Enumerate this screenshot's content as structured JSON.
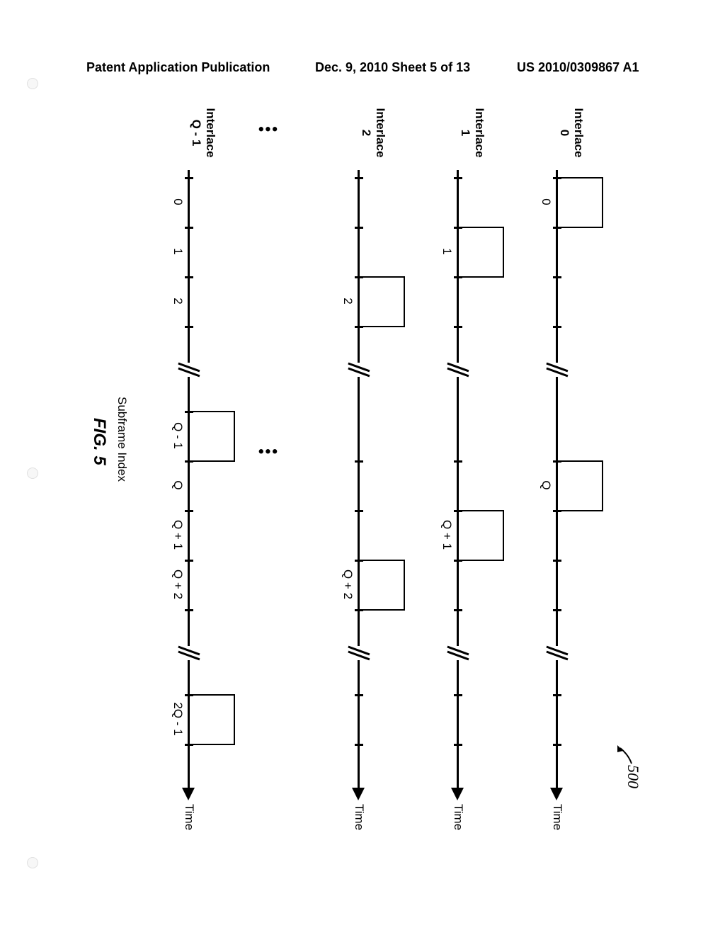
{
  "header": {
    "left": "Patent Application Publication",
    "mid": "Dec. 9, 2010   Sheet 5 of 13",
    "right": "US 2010/0309867 A1"
  },
  "ref_num": "500",
  "fig_label": "FIG. 5",
  "xaxis_label": "Subframe Index",
  "time_label": "Time",
  "rows": [
    {
      "label_line1": "Interlace",
      "label_line2": "0",
      "slots": [
        {
          "pos": 0,
          "label": "0"
        },
        {
          "pos": 5,
          "label": "Q"
        }
      ],
      "ticks": [
        0,
        1,
        2,
        3,
        5,
        6,
        7,
        8,
        10,
        11
      ],
      "show_index_labels": false
    },
    {
      "label_line1": "Interlace",
      "label_line2": "1",
      "slots": [
        {
          "pos": 1,
          "label": "1"
        },
        {
          "pos": 6,
          "label": "Q + 1"
        }
      ],
      "ticks": [
        0,
        1,
        2,
        3,
        5,
        6,
        7,
        8,
        10,
        11
      ],
      "show_index_labels": false
    },
    {
      "label_line1": "Interlace",
      "label_line2": "2",
      "slots": [
        {
          "pos": 2,
          "label": "2"
        },
        {
          "pos": 7,
          "label": "Q + 2"
        }
      ],
      "ticks": [
        0,
        1,
        2,
        3,
        5,
        6,
        7,
        8,
        10,
        11
      ],
      "show_index_labels": false
    },
    {
      "label_line1": "Interlace",
      "label_line2": "Q - 1",
      "slots": [
        {
          "pos": 4,
          "label": "Q - 1"
        },
        {
          "pos": 10,
          "label": "2Q - 1"
        }
      ],
      "ticks": [
        0,
        1,
        2,
        3,
        4,
        5,
        6,
        7,
        8,
        10,
        11
      ],
      "show_index_labels": true,
      "index_labels": [
        {
          "pos": 0,
          "text": "0"
        },
        {
          "pos": 1,
          "text": "1"
        },
        {
          "pos": 2,
          "text": "2"
        },
        {
          "pos": 4,
          "text": "Q - 1"
        },
        {
          "pos": 5,
          "text": "Q"
        },
        {
          "pos": 6,
          "text": "Q + 1"
        },
        {
          "pos": 7,
          "text": "Q + 2"
        },
        {
          "pos": 10,
          "text": "2Q - 1"
        }
      ]
    }
  ],
  "vdots": "•••"
}
